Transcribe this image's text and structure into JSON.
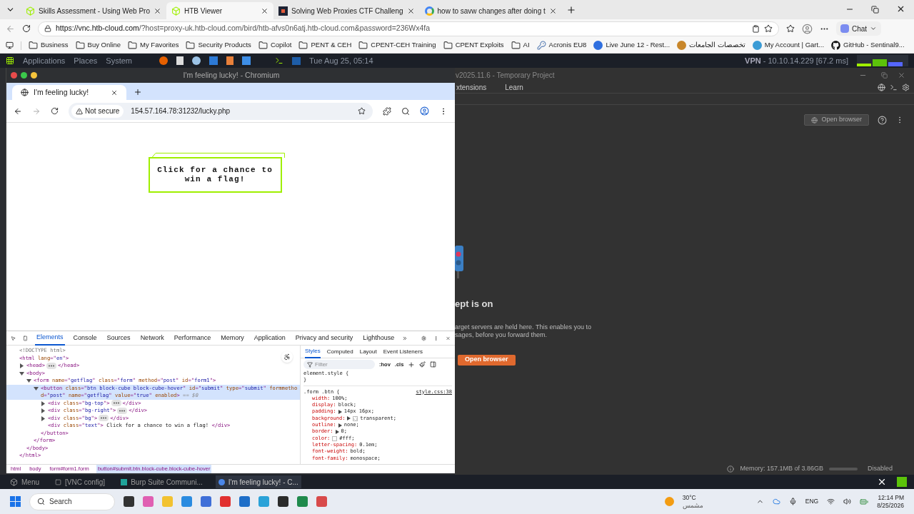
{
  "browser": {
    "tabs": [
      {
        "title": "Skills Assessment - Using Web Pro",
        "selected": false,
        "kind": "cube"
      },
      {
        "title": "HTB Viewer",
        "selected": true,
        "kind": "cube"
      },
      {
        "title": "Solving Web Proxies CTF Challeng",
        "selected": false,
        "kind": "site"
      },
      {
        "title": "how to savw changes after doing t",
        "selected": false,
        "kind": "google"
      }
    ],
    "url_host": "https://vnc.htb-cloud.com",
    "url_rest": "/?host=proxy-uk.htb-cloud.com/bird/htb-afvs0n6atj.htb-cloud.com&password=236Wx4fa",
    "chat_button": "Chat",
    "bookmarks": [
      {
        "label": "Business",
        "kind": "folder"
      },
      {
        "label": "Buy Online",
        "kind": "folder"
      },
      {
        "label": "My Favorites",
        "kind": "folder"
      },
      {
        "label": "Security Products",
        "kind": "folder"
      },
      {
        "label": "Copilot",
        "kind": "folder"
      },
      {
        "label": "PENT & CEH",
        "kind": "folder"
      },
      {
        "label": "CPENT-CEH Training",
        "kind": "folder"
      },
      {
        "label": "CPENT Exploits",
        "kind": "folder"
      },
      {
        "label": "AI",
        "kind": "folder"
      },
      {
        "label": "Acronis EU8",
        "kind": "key"
      },
      {
        "label": "Live June 12 - Rest...",
        "kind": "site",
        "color": "#2f6fdf"
      },
      {
        "label": "تخصصات الجامعات",
        "kind": "site",
        "color": "#c8862a"
      },
      {
        "label": "My Account | Gart...",
        "kind": "site",
        "color": "#3a9bd5"
      },
      {
        "label": "GitHub - Sentinal9...",
        "kind": "github"
      }
    ]
  },
  "vnc_panel": {
    "menus": [
      "Applications",
      "Places",
      "System"
    ],
    "clock": "Tue Aug 25, 05:14",
    "vpn_label": "VPN",
    "vpn_text": "- 10.10.14.229 [67.2 ms]"
  },
  "chromium": {
    "window_title": "I'm feeling lucky! - Chromium",
    "tab": "I'm feeling lucky!",
    "security": "Not secure",
    "url": "154.57.164.78:31232/lucky.php",
    "page_button": "Click for a chance to win a flag!",
    "devtools": {
      "tabs": [
        {
          "label": "Elements",
          "selected": true
        },
        {
          "label": "Console",
          "selected": false
        },
        {
          "label": "Sources",
          "selected": false
        },
        {
          "label": "Network",
          "selected": false
        },
        {
          "label": "Performance",
          "selected": false
        },
        {
          "label": "Memory",
          "selected": false
        },
        {
          "label": "Application",
          "selected": false
        },
        {
          "label": "Privacy and security",
          "selected": false
        },
        {
          "label": "Lighthouse",
          "selected": false
        }
      ],
      "dom": [
        {
          "open": [
            {
              "kind": "comment",
              "text": "<!DOCTYPE html>"
            }
          ],
          "selected": false
        },
        {
          "open": [
            {
              "kind": "tag",
              "text": "<html "
            },
            {
              "kind": "attr",
              "text": "lang"
            },
            {
              "kind": "tag",
              "text": "=\""
            },
            {
              "kind": "value",
              "text": "en"
            },
            {
              "kind": "tag",
              "text": "\">"
            }
          ],
          "close": [
            {
              "kind": "tag",
              "text": "</html>"
            }
          ],
          "selected": false,
          "children": [
            {
              "open": [
                {
                  "kind": "tag",
                  "text": "<head>"
                }
              ],
              "close": [
                {
                  "kind": "tag",
                  "text": "</head>"
                }
              ],
              "expanded": false,
              "selected": false
            },
            {
              "open": [
                {
                  "kind": "tag",
                  "text": "<body>"
                }
              ],
              "close": [
                {
                  "kind": "tag",
                  "text": "</body>"
                }
              ],
              "expanded": true,
              "selected": false,
              "children": [
                {
                  "open": [
                    {
                      "kind": "tag",
                      "text": "<form "
                    },
                    {
                      "kind": "attr",
                      "text": "name"
                    },
                    {
                      "kind": "tag",
                      "text": "=\""
                    },
                    {
                      "kind": "value",
                      "text": "getflag"
                    },
                    {
                      "kind": "tag",
                      "text": "\" "
                    },
                    {
                      "kind": "attr",
                      "text": "class"
                    },
                    {
                      "kind": "tag",
                      "text": "=\""
                    },
                    {
                      "kind": "value",
                      "text": "form"
                    },
                    {
                      "kind": "tag",
                      "text": "\" "
                    },
                    {
                      "kind": "attr",
                      "text": "method"
                    },
                    {
                      "kind": "tag",
                      "text": "=\""
                    },
                    {
                      "kind": "value",
                      "text": "post"
                    },
                    {
                      "kind": "tag",
                      "text": "\" "
                    },
                    {
                      "kind": "attr",
                      "text": "id"
                    },
                    {
                      "kind": "tag",
                      "text": "=\""
                    },
                    {
                      "kind": "value",
                      "text": "form1"
                    },
                    {
                      "kind": "tag",
                      "text": "\">"
                    }
                  ],
                  "close": [
                    {
                      "kind": "tag",
                      "text": "</form>"
                    }
                  ],
                  "expanded": true,
                  "selected": false,
                  "children": [
                    {
                      "open": [
                        {
                          "kind": "tag",
                          "text": "<button "
                        },
                        {
                          "kind": "attr",
                          "text": "class"
                        },
                        {
                          "kind": "tag",
                          "text": "=\""
                        },
                        {
                          "kind": "value",
                          "text": "btn block-cube block-cube-hover"
                        },
                        {
                          "kind": "tag",
                          "text": "\" "
                        },
                        {
                          "kind": "attr",
                          "text": "id"
                        },
                        {
                          "kind": "tag",
                          "text": "=\""
                        },
                        {
                          "kind": "value",
                          "text": "submit"
                        },
                        {
                          "kind": "tag",
                          "text": "\" "
                        },
                        {
                          "kind": "attr",
                          "text": "type"
                        },
                        {
                          "kind": "tag",
                          "text": "=\""
                        },
                        {
                          "kind": "value",
                          "text": "submit"
                        },
                        {
                          "kind": "tag",
                          "text": "\" "
                        },
                        {
                          "kind": "attr",
                          "text": "formmethod"
                        },
                        {
                          "kind": "tag",
                          "text": "=\""
                        },
                        {
                          "kind": "value",
                          "text": "post"
                        },
                        {
                          "kind": "tag",
                          "text": "\" "
                        },
                        {
                          "kind": "attr",
                          "text": "name"
                        },
                        {
                          "kind": "tag",
                          "text": "=\""
                        },
                        {
                          "kind": "value",
                          "text": "getflag"
                        },
                        {
                          "kind": "tag",
                          "text": "\" "
                        },
                        {
                          "kind": "attr",
                          "text": "value"
                        },
                        {
                          "kind": "tag",
                          "text": "=\""
                        },
                        {
                          "kind": "value",
                          "text": "true"
                        },
                        {
                          "kind": "tag",
                          "text": "\" "
                        },
                        {
                          "kind": "attr",
                          "text": "enabled"
                        },
                        {
                          "kind": "tag",
                          "text": ">"
                        },
                        {
                          "kind": "hint",
                          "text": " == $0"
                        }
                      ],
                      "close": [
                        {
                          "kind": "tag",
                          "text": "</button>"
                        }
                      ],
                      "expanded": true,
                      "selected": true,
                      "children": [
                        {
                          "open": [
                            {
                              "kind": "tag",
                              "text": "<div "
                            },
                            {
                              "kind": "attr",
                              "text": "class"
                            },
                            {
                              "kind": "tag",
                              "text": "=\""
                            },
                            {
                              "kind": "value",
                              "text": "bg-top"
                            },
                            {
                              "kind": "tag",
                              "text": "\">"
                            }
                          ],
                          "close": [
                            {
                              "kind": "tag",
                              "text": "</div>"
                            }
                          ],
                          "expanded": false,
                          "selected": false
                        },
                        {
                          "open": [
                            {
                              "kind": "tag",
                              "text": "<div "
                            },
                            {
                              "kind": "attr",
                              "text": "class"
                            },
                            {
                              "kind": "tag",
                              "text": "=\""
                            },
                            {
                              "kind": "value",
                              "text": "bg-right"
                            },
                            {
                              "kind": "tag",
                              "text": "\">"
                            }
                          ],
                          "close": [
                            {
                              "kind": "tag",
                              "text": "</div>"
                            }
                          ],
                          "expanded": false,
                          "selected": false
                        },
                        {
                          "open": [
                            {
                              "kind": "tag",
                              "text": "<div "
                            },
                            {
                              "kind": "attr",
                              "text": "class"
                            },
                            {
                              "kind": "tag",
                              "text": "=\""
                            },
                            {
                              "kind": "value",
                              "text": "bg"
                            },
                            {
                              "kind": "tag",
                              "text": "\">"
                            }
                          ],
                          "close": [
                            {
                              "kind": "tag",
                              "text": "</div>"
                            }
                          ],
                          "expanded": false,
                          "selected": false
                        },
                        {
                          "open": [
                            {
                              "kind": "tag",
                              "text": "<div "
                            },
                            {
                              "kind": "attr",
                              "text": "class"
                            },
                            {
                              "kind": "tag",
                              "text": "=\""
                            },
                            {
                              "kind": "value",
                              "text": "text"
                            },
                            {
                              "kind": "tag",
                              "text": "\">"
                            },
                            {
                              "kind": "text",
                              "text": " Click for a chance to win a flag! "
                            },
                            {
                              "kind": "tag",
                              "text": "</div>"
                            }
                          ],
                          "selected": false
                        }
                      ]
                    }
                  ]
                }
              ]
            }
          ]
        }
      ],
      "style_tabs": [
        {
          "label": "Styles",
          "selected": true
        },
        {
          "label": "Computed",
          "selected": false
        },
        {
          "label": "Layout",
          "selected": false
        },
        {
          "label": "Event Listeners",
          "selected": false
        }
      ],
      "filter_placeholder": "Filter",
      "hov": ":hov",
      "cls": ".cls",
      "element_style_open": "element.style {",
      "element_style_close": "}",
      "rule_selector": ".form .btn {",
      "rule_source": "style.css:38",
      "declarations": [
        {
          "prop": "width:",
          "value": "100%;",
          "expandable": false
        },
        {
          "prop": "display:",
          "value": "block;",
          "expandable": false
        },
        {
          "prop": "padding:",
          "value": "14px 16px;",
          "expandable": true
        },
        {
          "prop": "background:",
          "value": "transparent;",
          "expandable": true,
          "kind": "checker"
        },
        {
          "prop": "outline:",
          "value": "none;",
          "expandable": true
        },
        {
          "prop": "border:",
          "value": "0;",
          "expandable": true
        },
        {
          "prop": "color:",
          "value": "#fff;",
          "expandable": false,
          "kind": "swatch",
          "color": "#ffffff"
        },
        {
          "prop": "letter-spacing:",
          "value": "0.1em;",
          "expandable": false
        },
        {
          "prop": "font-weight:",
          "value": "bold;",
          "expandable": false
        },
        {
          "prop": "font-family:",
          "value": "monospace;",
          "expandable": false
        }
      ],
      "breadcrumbs": [
        {
          "label": "html",
          "selected": false
        },
        {
          "label": "body",
          "selected": false
        },
        {
          "label": "form#form1.form",
          "selected": false
        },
        {
          "label": "button#submit.btn.block-cube.block-cube-hover",
          "selected": true
        }
      ]
    }
  },
  "burp": {
    "title": "v2025.11.6 - Temporary Project",
    "menus": [
      "xtensions",
      "Learn"
    ],
    "open_browser_top": "Open browser",
    "heading": "ept is on",
    "description": [
      "arget servers are held here. This enables you to",
      "sages, before you forward them."
    ],
    "open_browser": "Open browser",
    "memory": "Memory: 157.1MB of 3.86GB",
    "disabled": "Disabled"
  },
  "vnc_taskbar": [
    {
      "label": "Menu",
      "kind": "menu",
      "selected": false
    },
    {
      "label": "[VNC config]",
      "kind": "window",
      "selected": false
    },
    {
      "label": "Burp Suite Communi...",
      "kind": "burp",
      "selected": false
    },
    {
      "label": "I'm feeling lucky! - C...",
      "kind": "chrome",
      "selected": true
    }
  ],
  "windows_taskbar": {
    "search": "Search",
    "temperature": "30°C",
    "weather": "مشمس",
    "language": "ENG",
    "time": "12:14 PM",
    "date": "8/25/2026"
  }
}
